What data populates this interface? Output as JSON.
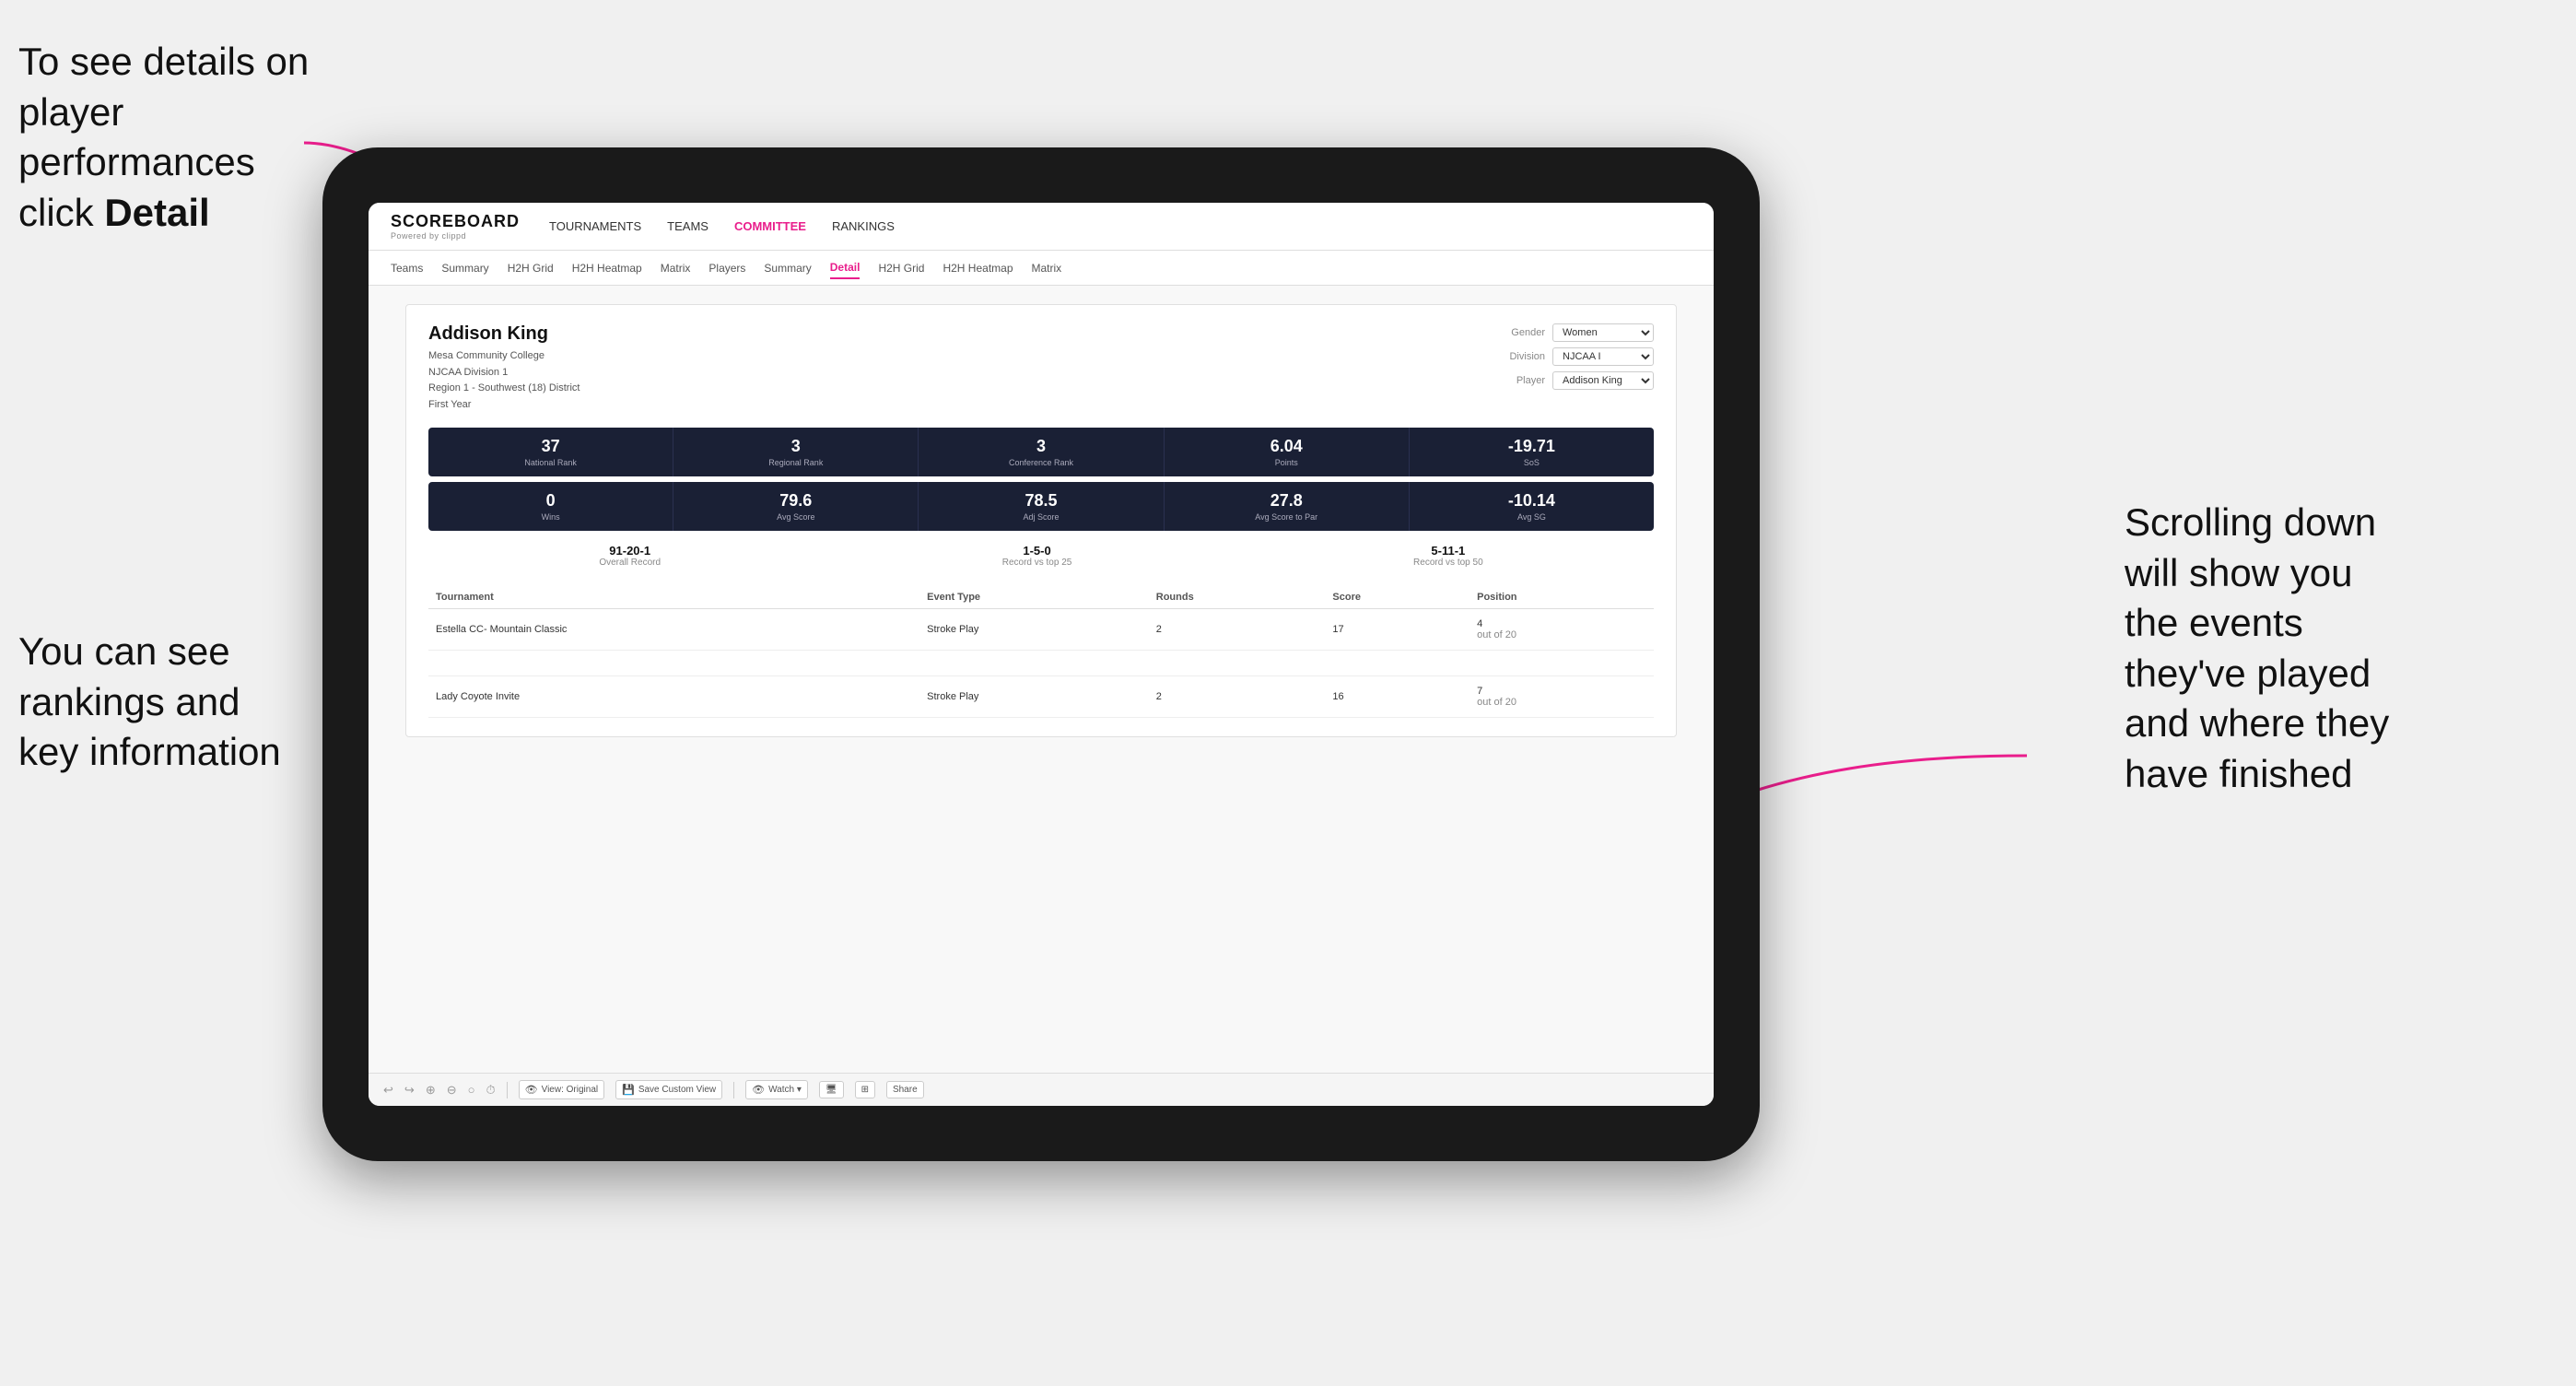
{
  "annotations": {
    "top_left": {
      "line1": "To see details on",
      "line2": "player performances",
      "line3_prefix": "click ",
      "line3_bold": "Detail"
    },
    "bottom_left": {
      "line1": "You can see",
      "line2": "rankings and",
      "line3": "key information"
    },
    "right": {
      "line1": "Scrolling down",
      "line2": "will show you",
      "line3": "the events",
      "line4": "they've played",
      "line5": "and where they",
      "line6": "have finished"
    }
  },
  "nav": {
    "logo": "SCOREBOARD",
    "logo_sub": "Powered by clippd",
    "top_items": [
      {
        "label": "TOURNAMENTS",
        "active": false
      },
      {
        "label": "TEAMS",
        "active": false
      },
      {
        "label": "COMMITTEE",
        "active": false,
        "highlight": true
      },
      {
        "label": "RANKINGS",
        "active": false
      }
    ],
    "sub_items": [
      {
        "label": "Teams",
        "active": false
      },
      {
        "label": "Summary",
        "active": false
      },
      {
        "label": "H2H Grid",
        "active": false
      },
      {
        "label": "H2H Heatmap",
        "active": false
      },
      {
        "label": "Matrix",
        "active": false
      },
      {
        "label": "Players",
        "active": false
      },
      {
        "label": "Summary",
        "active": false
      },
      {
        "label": "Detail",
        "active": true
      },
      {
        "label": "H2H Grid",
        "active": false
      },
      {
        "label": "H2H Heatmap",
        "active": false
      },
      {
        "label": "Matrix",
        "active": false
      }
    ]
  },
  "player": {
    "name": "Addison King",
    "college": "Mesa Community College",
    "division": "NJCAA Division 1",
    "region": "Region 1 - Southwest (18) District",
    "year": "First Year",
    "gender_label": "Gender",
    "gender_value": "Women",
    "division_label": "Division",
    "division_value": "NJCAA I",
    "player_label": "Player",
    "player_value": "Addison King"
  },
  "stats_row1": [
    {
      "value": "37",
      "label": "National Rank"
    },
    {
      "value": "3",
      "label": "Regional Rank"
    },
    {
      "value": "3",
      "label": "Conference Rank"
    },
    {
      "value": "6.04",
      "label": "Points"
    },
    {
      "value": "-19.71",
      "label": "SoS"
    }
  ],
  "stats_row2": [
    {
      "value": "0",
      "label": "Wins"
    },
    {
      "value": "79.6",
      "label": "Avg Score"
    },
    {
      "value": "78.5",
      "label": "Adj Score"
    },
    {
      "value": "27.8",
      "label": "Avg Score to Par"
    },
    {
      "value": "-10.14",
      "label": "Avg SG"
    }
  ],
  "records": [
    {
      "value": "91-20-1",
      "label": "Overall Record"
    },
    {
      "value": "1-5-0",
      "label": "Record vs top 25"
    },
    {
      "value": "5-11-1",
      "label": "Record vs top 50"
    }
  ],
  "table": {
    "headers": [
      "Tournament",
      "Event Type",
      "Rounds",
      "Score",
      "Position"
    ],
    "rows": [
      {
        "tournament": "Estella CC- Mountain Classic",
        "event_type": "Stroke Play",
        "rounds": "2",
        "score": "17",
        "position": "4\nout of 20"
      },
      {
        "tournament": "",
        "event_type": "",
        "rounds": "",
        "score": "",
        "position": ""
      },
      {
        "tournament": "Lady Coyote Invite",
        "event_type": "Stroke Play",
        "rounds": "2",
        "score": "16",
        "position": "7\nout of 20"
      }
    ]
  },
  "toolbar": {
    "buttons": [
      {
        "label": "↩"
      },
      {
        "label": "↪"
      },
      {
        "label": "⊕"
      },
      {
        "label": "⊖"
      },
      {
        "label": "⊙"
      },
      {
        "label": "⏱"
      },
      {
        "label": "👁 View: Original"
      },
      {
        "label": "💾 Save Custom View"
      },
      {
        "label": "👁 Watch ▾"
      },
      {
        "label": "🖥"
      },
      {
        "label": "⊞"
      },
      {
        "label": "Share"
      }
    ]
  }
}
